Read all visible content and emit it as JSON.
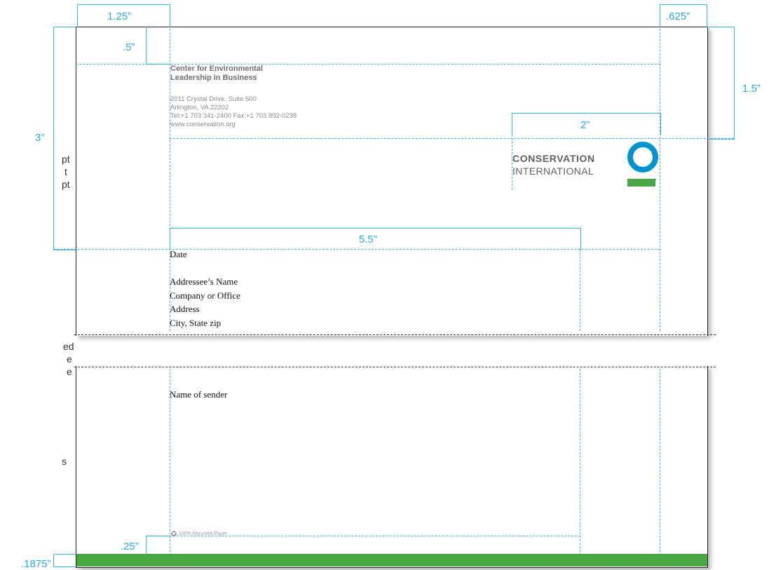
{
  "org": {
    "name_line1": "Center for Environmental",
    "name_line2": "Leadership in Business",
    "address1": "2011 Crystal Drive, Suite 500",
    "address2": "Arlington, VA 22202",
    "phones": "Tel:+1 703 341-2400 Fax:+1 703 892-0238",
    "website": "www.conservation.org"
  },
  "logo": {
    "line1": "CONSERVATION",
    "line2": "INTERNATIONAL",
    "ring_color": "#0093d0",
    "bar_color": "#47a843",
    "icon": "ci-logo-icon"
  },
  "letter": {
    "date": "Date",
    "addressee": "Addressee’s Name",
    "company": "Company or Office",
    "address": "Address",
    "city": "City, State zip",
    "sender": "Name of sender"
  },
  "footer": {
    "recycled": "100% Recycled Paper",
    "recycle_icon": "recycle-icon",
    "bar_color": "#47a843"
  },
  "dimensions": {
    "left_margin": "1.25”",
    "right_margin": ".625”",
    "top_offset": ".5”",
    "logo_top": "1.5”",
    "logo_width": "2”",
    "address_top": "3”",
    "address_width": "5.5”",
    "footer_offset": ".25”",
    "bottom_bar": ".1875”"
  },
  "side_notes": [
    "pt",
    "t",
    "pt",
    "ed",
    "e",
    "e",
    "s"
  ],
  "colors": {
    "guide": "#3ab4de",
    "dimension_text": "#29a9db"
  }
}
